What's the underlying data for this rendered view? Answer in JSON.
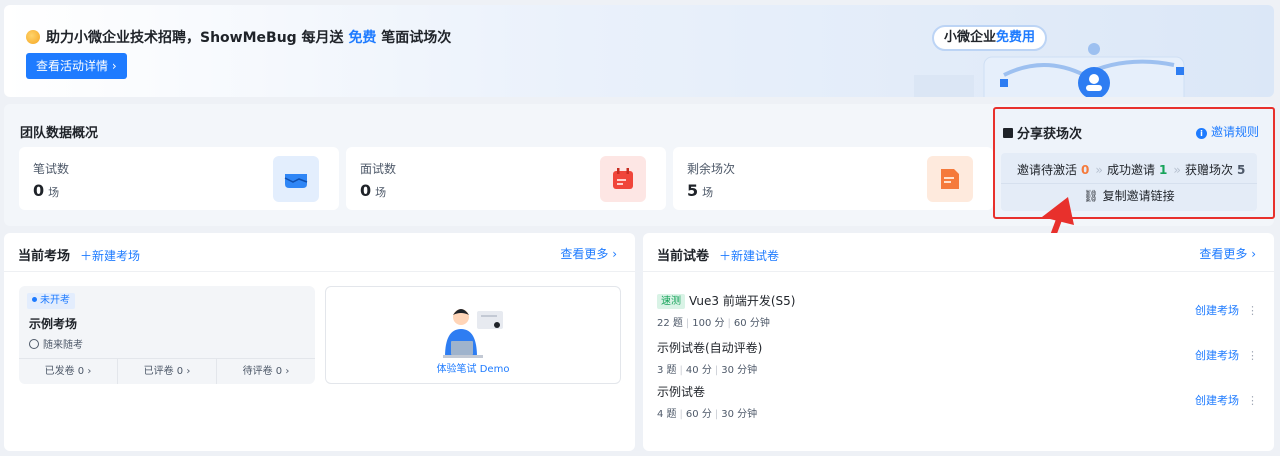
{
  "banner": {
    "title_prefix": "助力小微企业技术招聘，ShowMeBug 每月送 ",
    "title_highlight": "免费",
    "title_suffix": " 笔面试场次",
    "button_label": "查看活动详情",
    "tag_prefix": "小微企业",
    "tag_highlight": "免费用"
  },
  "team": {
    "title": "团队数据概况",
    "stats": [
      {
        "label": "笔试数",
        "value": "0",
        "unit": "场",
        "color": "#2f86f6"
      },
      {
        "label": "面试数",
        "value": "0",
        "unit": "场",
        "color": "#f0453a"
      },
      {
        "label": "剩余场次",
        "value": "5",
        "unit": "场",
        "color": "#f57a3b"
      }
    ]
  },
  "share": {
    "title": "分享获场次",
    "rule_label": "邀请规则",
    "pending_label": "邀请待激活",
    "pending_value": "0",
    "success_label": "成功邀请",
    "success_value": "1",
    "gift_label": "获赠场次",
    "gift_value": "5",
    "copy_label": "复制邀请链接"
  },
  "exam_panel": {
    "title": "当前考场",
    "new_label": "新建考场",
    "more_label": "查看更多",
    "card": {
      "status": "未开考",
      "name": "示例考场",
      "mode": "随来随考",
      "footer": [
        "已发卷 0",
        "已评卷 0",
        "待评卷 0"
      ]
    },
    "demo_label": "体验笔试 Demo"
  },
  "paper_panel": {
    "title": "当前试卷",
    "new_label": "新建试卷",
    "more_label": "查看更多",
    "action_label": "创建考场",
    "papers": [
      {
        "tag": "速测",
        "name": "Vue3 前端开发(S5)",
        "meta": [
          "22 题",
          "100 分",
          "60 分钟"
        ]
      },
      {
        "tag": "",
        "name": "示例试卷(自动评卷)",
        "meta": [
          "3 题",
          "40 分",
          "30 分钟"
        ]
      },
      {
        "tag": "",
        "name": "示例试卷",
        "meta": [
          "4 题",
          "60 分",
          "30 分钟"
        ]
      }
    ]
  },
  "colors": {
    "accent": "#1e7bff",
    "highlight_border": "#e8302c"
  }
}
